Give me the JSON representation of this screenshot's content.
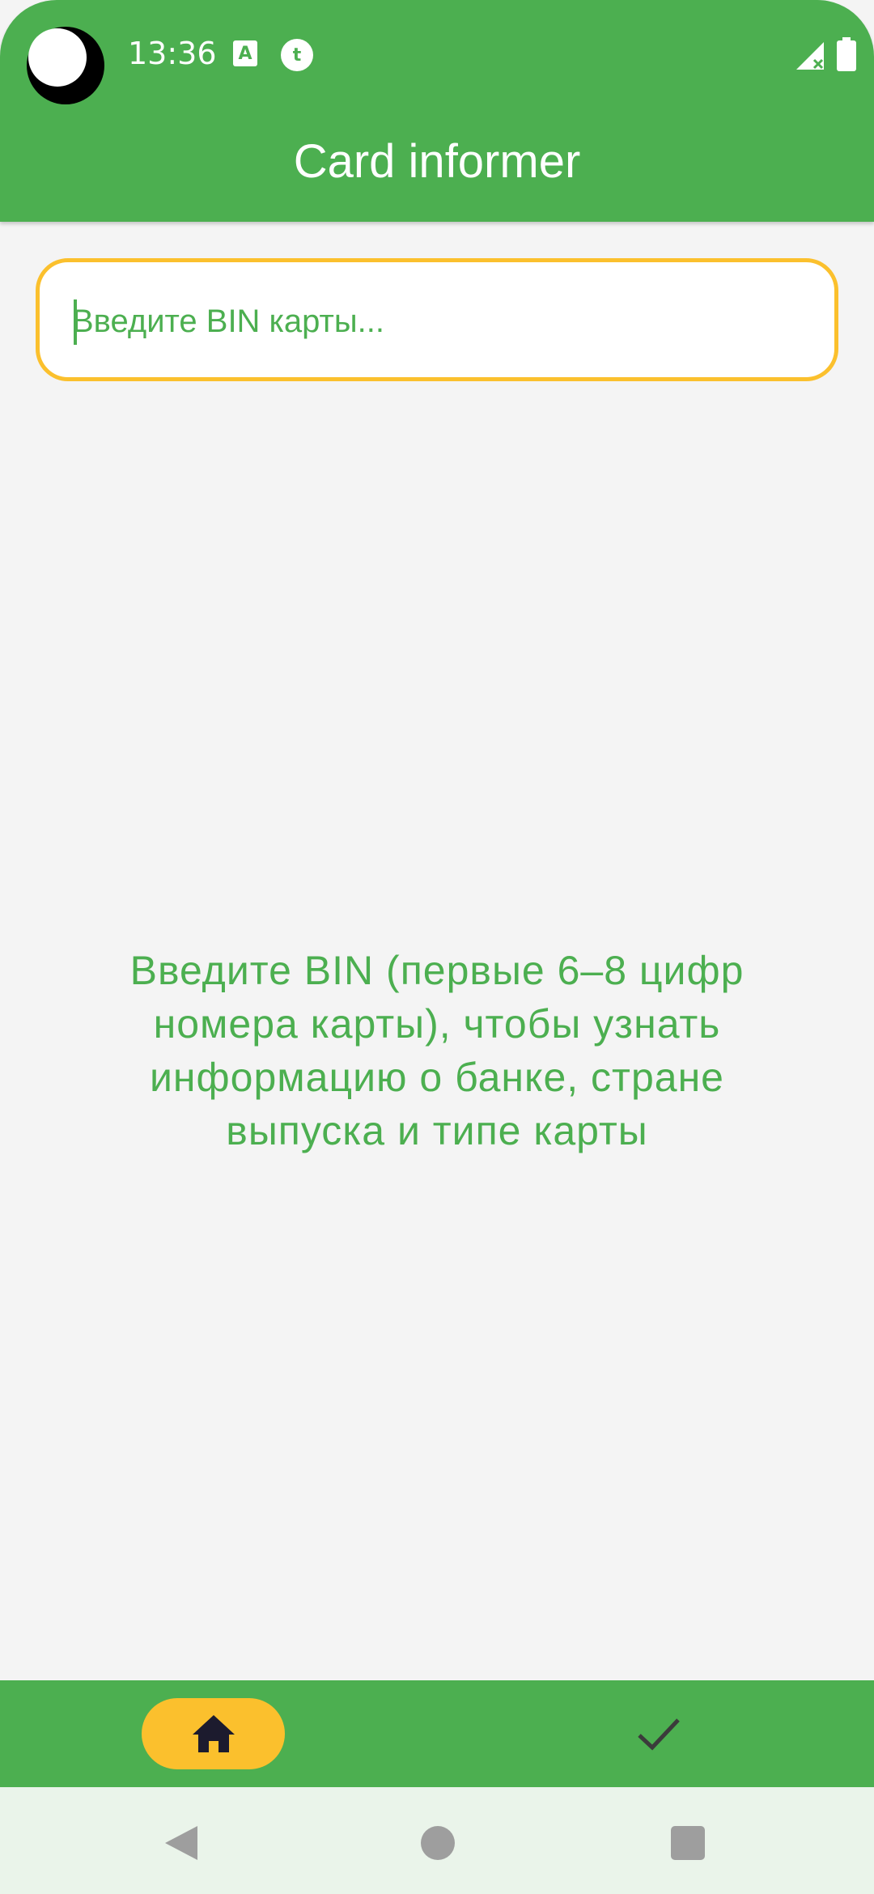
{
  "status_bar": {
    "time": "13:36",
    "icons": [
      "notification-a-icon",
      "notification-t-icon",
      "signal-icon",
      "battery-icon"
    ]
  },
  "app_bar": {
    "title": "Card informer"
  },
  "search": {
    "placeholder": "Введите BIN карты...",
    "value": ""
  },
  "main": {
    "hint": "Введите BIN (первые 6–8 цифр номера карты), чтобы узнать информацию о банке, стране выпуска и типе карты"
  },
  "bottom_nav": {
    "items": [
      {
        "icon": "home-icon",
        "selected": true
      },
      {
        "icon": "check-icon",
        "selected": false
      }
    ]
  },
  "system_nav": {
    "buttons": [
      "back-icon",
      "home-circle-icon",
      "recents-icon"
    ]
  },
  "colors": {
    "primary": "#4caf50",
    "accent": "#fbc02d",
    "background": "#f4f4f4"
  }
}
